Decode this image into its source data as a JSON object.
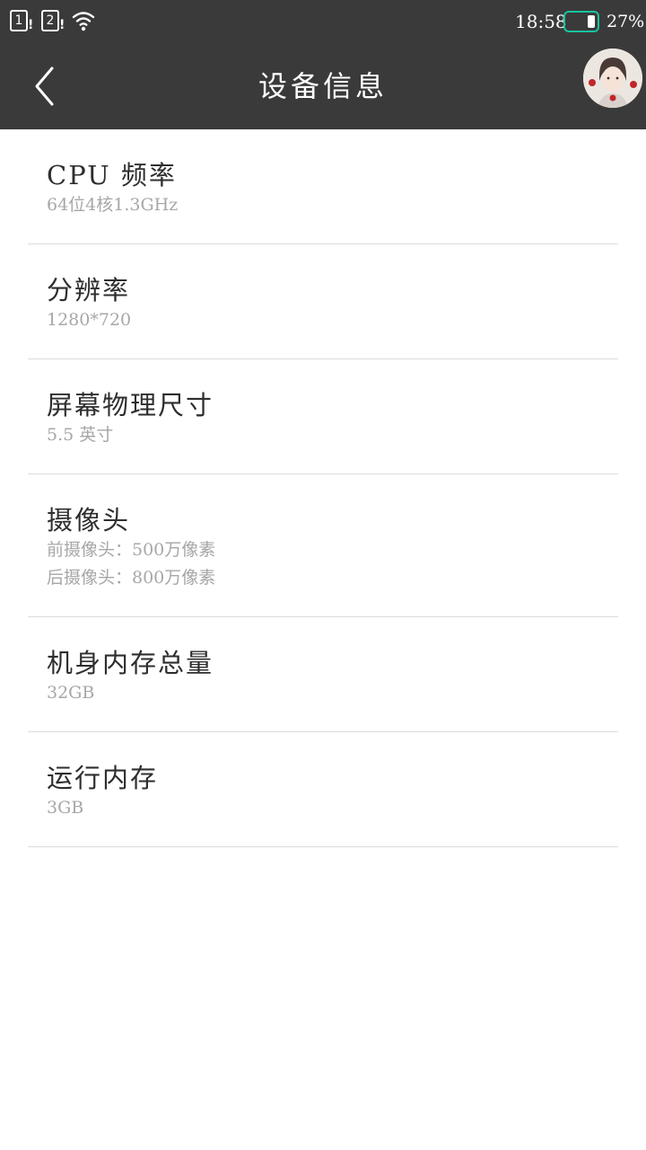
{
  "status_bar": {
    "sim1": "1",
    "sim2": "2",
    "time": "18:58",
    "battery_percent": "27%",
    "battery_level": 0.27,
    "battery_color": "#19c3a0",
    "icons": [
      "sim-1-icon",
      "sim-2-icon",
      "wifi-icon",
      "battery-icon"
    ]
  },
  "app_bar": {
    "title": "设备信息",
    "background": "#3a3a3a",
    "icons": [
      "back-arrow-icon",
      "avatar"
    ]
  },
  "items": [
    {
      "title": "CPU 频率",
      "value": "64位4核1.3GHz"
    },
    {
      "title": "分辨率",
      "value": "1280*720"
    },
    {
      "title": "屏幕物理尺寸",
      "value": "5.5 英寸"
    },
    {
      "title": "摄像头",
      "value": "前摄像头：500万像素",
      "value2": "后摄像头：800万像素"
    },
    {
      "title": "机身内存总量",
      "value": "32GB"
    },
    {
      "title": "运行内存",
      "value": "3GB"
    }
  ]
}
